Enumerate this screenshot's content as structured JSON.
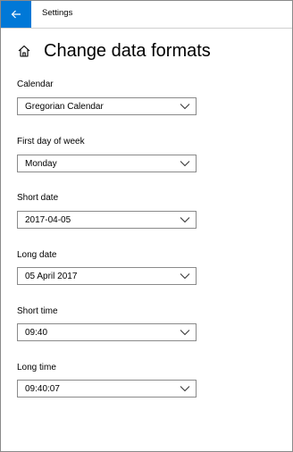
{
  "window": {
    "title": "Settings"
  },
  "page": {
    "title": "Change data formats"
  },
  "fields": [
    {
      "label": "Calendar",
      "value": "Gregorian Calendar"
    },
    {
      "label": "First day of week",
      "value": "Monday"
    },
    {
      "label": "Short date",
      "value": "2017-04-05"
    },
    {
      "label": "Long date",
      "value": "05 April 2017"
    },
    {
      "label": "Short time",
      "value": "09:40"
    },
    {
      "label": "Long time",
      "value": "09:40:07"
    }
  ],
  "colors": {
    "accent": "#0078d7",
    "border": "#8a8a8a"
  },
  "icons": {
    "back": "back-arrow-icon",
    "home": "home-icon",
    "dropdown": "chevron-down-icon"
  }
}
